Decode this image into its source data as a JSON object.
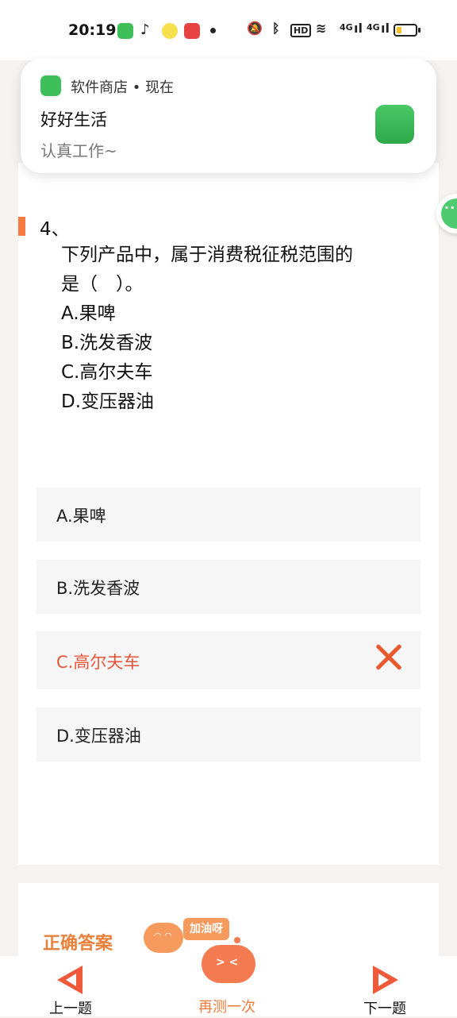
{
  "status_bar": {
    "time": "20:19",
    "icons_left": [
      "app-store-icon",
      "tiktok-icon",
      "emoji-app-icon",
      "video-app-icon",
      "more-dot-icon"
    ],
    "icons_right": [
      "mute-icon",
      "bluetooth-icon",
      "hd-icon",
      "wifi-icon",
      "signal-4g-icon",
      "signal-4g-icon",
      "battery-icon"
    ],
    "hd_label": "HD",
    "net_label_1": "4G",
    "net_label_2": "4G",
    "battery_level": 0.25,
    "battery_color": "#f2c12e"
  },
  "notification": {
    "source": "软件商店 • 现在",
    "title": "好好生活",
    "body": "认真工作~",
    "app_color": "#3fbf5a"
  },
  "question": {
    "number": "4、",
    "lines": [
      "下列产品中，属于消费税征税范围的",
      "是（　）。",
      "A.果啤",
      "B.洗发香波",
      "C.高尔夫车",
      "D.变压器油"
    ],
    "marker_color": "#f47a3f"
  },
  "options": [
    {
      "label": "A.果啤",
      "state": "normal"
    },
    {
      "label": "B.洗发香波",
      "state": "normal"
    },
    {
      "label": "C.高尔夫车",
      "state": "wrong"
    },
    {
      "label": "D.变压器油",
      "state": "normal"
    }
  ],
  "answer_section": {
    "title": "正确答案",
    "cheer": "加油呀"
  },
  "bottom_nav": {
    "prev": "上一题",
    "retry": "再测一次",
    "next": "下一题",
    "accent": "#f05a3a"
  }
}
